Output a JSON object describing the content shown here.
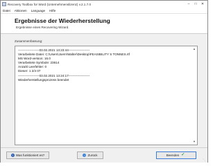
{
  "window": {
    "title": "Recovery Toolbox for Word (Unternehmenslizenz) v.2.1.7.0",
    "minimize_icon": "minimize-icon",
    "maximize_icon": "maximize-icon",
    "close_icon": "close-icon"
  },
  "menu": [
    "Datei",
    "Aktionen",
    "Language",
    "Hilfe"
  ],
  "header": {
    "title": "Ergebnisse der Wiederherstellung",
    "subtitle": "Ergebnisse eines Recovering Wizard."
  },
  "content": {
    "label": "Zusammenfassung:",
    "log": [
      "--------------------03.02.2021 13:23:44--------------------",
      "Verarbeitete Datei: C:\\Users\\Joern\\Walter\\Desktop\\FEASIBILITY S TONNES.rtf",
      "MS Word-version: 16.0",
      "Verarbeitete Symbole: 23614",
      "Anzahl Leerfehler: 0",
      "Dieser: 1 2/4 07",
      "--------------------03.02.2021 13:24:17--------------------",
      "Wiederherstellungsprozess beendet"
    ]
  },
  "footer": {
    "help_label": "Was funktioniert es?",
    "back_label": "Zurück",
    "finish_label": "Beenden"
  }
}
